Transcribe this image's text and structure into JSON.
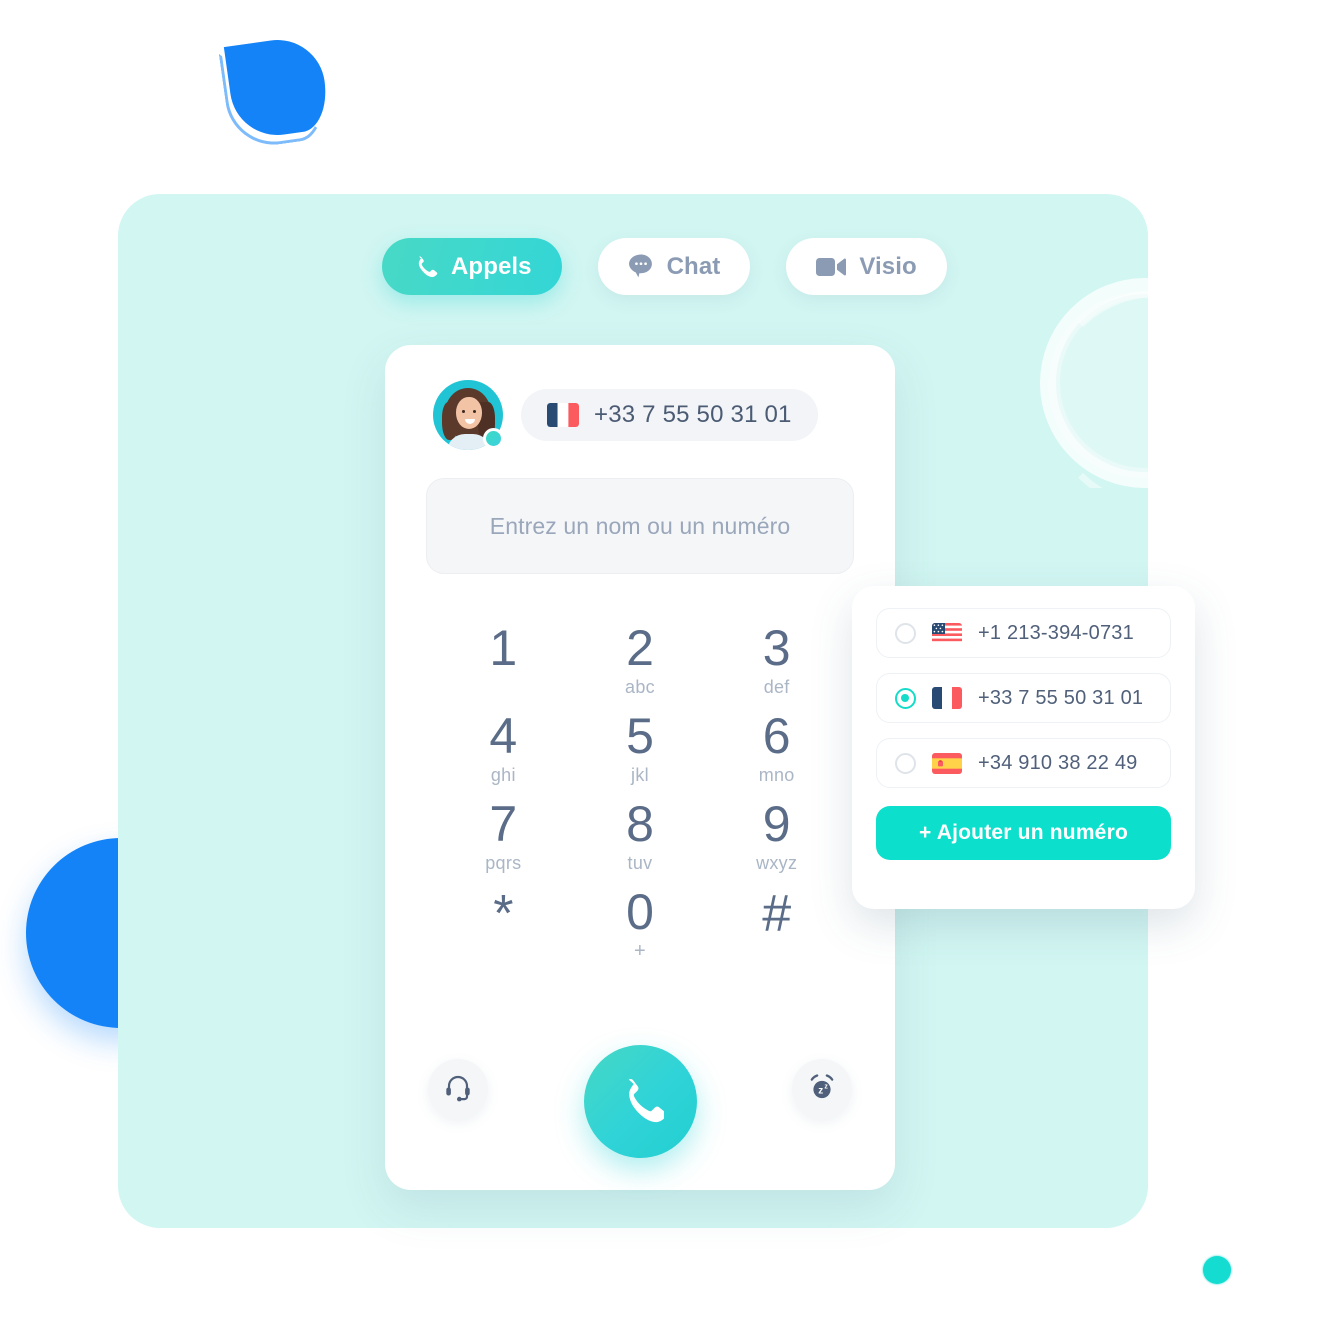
{
  "tabs": [
    {
      "label": "Appels",
      "icon": "phone-icon",
      "active": true
    },
    {
      "label": "Chat",
      "icon": "chat-bubble-icon",
      "active": false
    },
    {
      "label": "Visio",
      "icon": "video-camera-icon",
      "active": false
    }
  ],
  "dialer": {
    "active_number": "+33 7 55 50 31 01",
    "active_flag": "flag-france",
    "avatar": "user-avatar",
    "presence": "online",
    "search_placeholder": "Entrez un nom ou un numéro",
    "search_value": "",
    "keypad": [
      {
        "digit": "1",
        "sub": ""
      },
      {
        "digit": "2",
        "sub": "abc"
      },
      {
        "digit": "3",
        "sub": "def"
      },
      {
        "digit": "4",
        "sub": "ghi"
      },
      {
        "digit": "5",
        "sub": "jkl"
      },
      {
        "digit": "6",
        "sub": "mno"
      },
      {
        "digit": "7",
        "sub": "pqrs"
      },
      {
        "digit": "8",
        "sub": "tuv"
      },
      {
        "digit": "9",
        "sub": "wxyz"
      },
      {
        "digit": "*",
        "sub": ""
      },
      {
        "digit": "0",
        "sub": "+"
      },
      {
        "digit": "#",
        "sub": ""
      }
    ],
    "actions": {
      "headset": "headset-icon",
      "call": "phone-call-icon",
      "snooze": "alarm-snooze-icon"
    }
  },
  "numbers_dropdown": {
    "items": [
      {
        "number": "+1 213-394-0731",
        "flag": "flag-usa",
        "selected": false
      },
      {
        "number": "+33 7 55 50 31 01",
        "flag": "flag-france",
        "selected": true
      },
      {
        "number": "+34 910 38 22 49",
        "flag": "flag-spain",
        "selected": false
      }
    ],
    "add_label": "+ Ajouter un numéro"
  },
  "colors": {
    "accent_teal": "#0ce0cc",
    "accent_teal_gradient_start": "#48d9c6",
    "accent_teal_gradient_end": "#33d6d6",
    "mint_panel": "#d2f6f2",
    "brand_blue": "#1383f7",
    "text_slate": "#5a6c87",
    "text_muted": "#aab6c6",
    "tab_inactive_text": "#8b9bb4"
  }
}
